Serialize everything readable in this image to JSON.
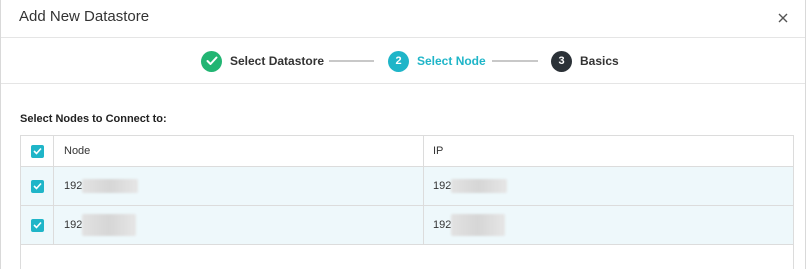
{
  "dialog": {
    "title": "Add New Datastore",
    "close_icon": "close-icon"
  },
  "wizard": {
    "steps": [
      {
        "label": "Select Datastore",
        "state": "completed",
        "icon": "check-icon"
      },
      {
        "label": "Select Node",
        "state": "active",
        "number": "2"
      },
      {
        "label": "Basics",
        "state": "pending",
        "number": "3"
      }
    ]
  },
  "colors": {
    "completed": "#22b573",
    "active": "#1fb5c8",
    "pending": "#2b3137",
    "row_selected": "#eef8fb"
  },
  "section_label": "Select Nodes to Connect to:",
  "table": {
    "columns": {
      "node": "Node",
      "ip": "IP"
    },
    "rows": [
      {
        "node": "192",
        "ip": "192",
        "checked": true
      },
      {
        "node": "192",
        "ip": "192",
        "checked": true
      }
    ]
  }
}
